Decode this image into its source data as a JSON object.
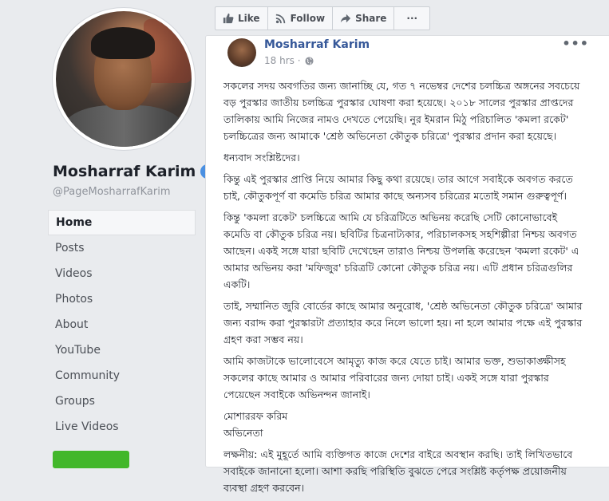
{
  "sidebar": {
    "page_name": "Mosharraf Karim",
    "handle": "@PageMosharrafKarim",
    "items": [
      {
        "label": "Home"
      },
      {
        "label": "Posts"
      },
      {
        "label": "Videos"
      },
      {
        "label": "Photos"
      },
      {
        "label": "About"
      },
      {
        "label": "YouTube"
      },
      {
        "label": "Community"
      },
      {
        "label": "Groups"
      },
      {
        "label": "Live Videos"
      }
    ]
  },
  "actions": {
    "like": "Like",
    "follow": "Follow",
    "share": "Share",
    "more": "···"
  },
  "post": {
    "author": "Mosharraf Karim",
    "time": "18 hrs · ",
    "more": "•••",
    "paragraphs": [
      "সকলের সদয় অবগতির জন্য জানাচ্ছি যে, গত ৭ নভেম্বর দেশের চলচ্চিত্র অঙ্গনের সবচেয়ে বড় পুরস্কার জাতীয় চলচ্চিত্র পুরস্কার ঘোষণা করা হয়েছে। ২০১৮ সালের পুরস্কার প্রাপ্তদের তালিকায় আমি নিজের নামও দেখতে পেয়েছি। নুর ইমরান মিঠু পরিচালিত 'কমলা রকেট' চলচ্চিত্রের জন্য আমাকে 'শ্রেষ্ঠ অভিনেতা কৌতুক চরিত্রে' পুরস্কার প্রদান করা হয়েছে।",
      "ধন্যবাদ সংশ্লিষ্টদের।",
      "কিন্তু এই পুরস্কার প্রাপ্তি নিয়ে আমার কিছু কথা রয়েছে। তার আগে সবাইকে অবগত করতে চাই, কৌতুকপূর্ণ বা কমেডি চরিত্র আমার কাছে অন্যসব চরিত্রের মতোই সমান গুরুত্বপূর্ণ।",
      "কিন্তু 'কমলা রকেট' চলচ্চিত্রে আমি যে চরিত্রটিতে অভিনয় করেছি সেটি কোনোভাবেই কমেডি বা কৌতুক চরিত্র নয়। ছবিটির চিত্রনাট্যকার, পরিচালকসহ সহশিল্পীরা নিশ্চয় অবগত আছেন। একই সঙ্গে যারা ছবিটি দেখেছেন তারাও নিশ্চয় উপলব্ধি করেছেন 'কমলা রকেট' এ আমার অভিনয় করা 'মফিজুর' চরিত্রটি কোনো কৌতুক চরিত্র নয়। এটি প্রধান চরিত্রগুলির একটি।",
      "তাই, সম্মানিত জুরি বোর্ডের কাছে আমার অনুরোধ, 'শ্রেষ্ঠ অভিনেতা কৌতুক চরিত্রে' আমার জন্য বরাদ্দ করা পুরস্কারটা প্রত্যাহার করে নিলে ভালো হয়। না হলে আমার পক্ষে এই পুরস্কার গ্রহণ করা সম্ভব নয়।",
      "আমি কাজটাকে ভালোবেসে আমৃত্যু কাজ করে যেতে চাই। আমার ভক্ত, শুভাকাঙ্ক্ষীসহ সকলের কাছে আমার ও আমার পরিবারের জন্য দোয়া চাই। একই সঙ্গে যারা পুরস্কার পেয়েছেন সবাইকে অভিনন্দন জানাই।"
    ],
    "signature_name": "মোশাররফ করিম",
    "signature_role": "অভিনেতা",
    "note": "লক্ষনীয়: এই মুহূর্তে আমি ব্যক্তিগত কাজে দেশের বাইরে অবস্থান করছি। তাই লিখিতভাবে সবাইকে জানানো হলো। আশা করছি পরিস্থিতি বুঝতে পেরে সংশ্লিষ্ট কর্তৃপক্ষ প্রয়োজনীয় ব্যবস্থা গ্রহণ করবেন।"
  },
  "colors": {
    "link_blue": "#365899",
    "verified_blue": "#4a90e2",
    "create_green": "#42b72a"
  }
}
